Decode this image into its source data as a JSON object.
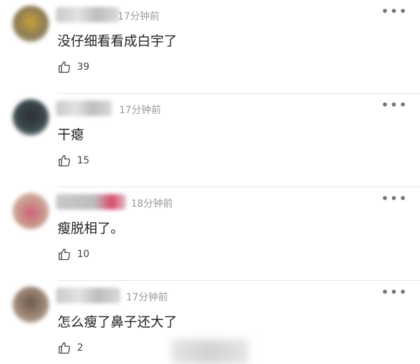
{
  "comments": [
    {
      "time": "17分钟前",
      "text": "没仔细看看成白宇了",
      "likes": "39",
      "avatar_color": "#c9a23a",
      "more_icon": "more-dots-icon",
      "like_icon": "thumbs-up-icon"
    },
    {
      "time": "17分钟前",
      "text": "干瘪",
      "likes": "15",
      "avatar_color": "#2b2f33",
      "more_icon": "more-dots-icon",
      "like_icon": "thumbs-up-icon"
    },
    {
      "time": "18分钟前",
      "text": "瘦脱相了。",
      "likes": "10",
      "avatar_color": "#c99a8c",
      "more_icon": "more-dots-icon",
      "like_icon": "thumbs-up-icon"
    },
    {
      "time": "17分钟前",
      "text": "怎么瘦了鼻子还大了",
      "likes": "2",
      "avatar_color": "#6b5a4f",
      "more_icon": "more-dots-icon",
      "like_icon": "thumbs-up-icon"
    }
  ]
}
